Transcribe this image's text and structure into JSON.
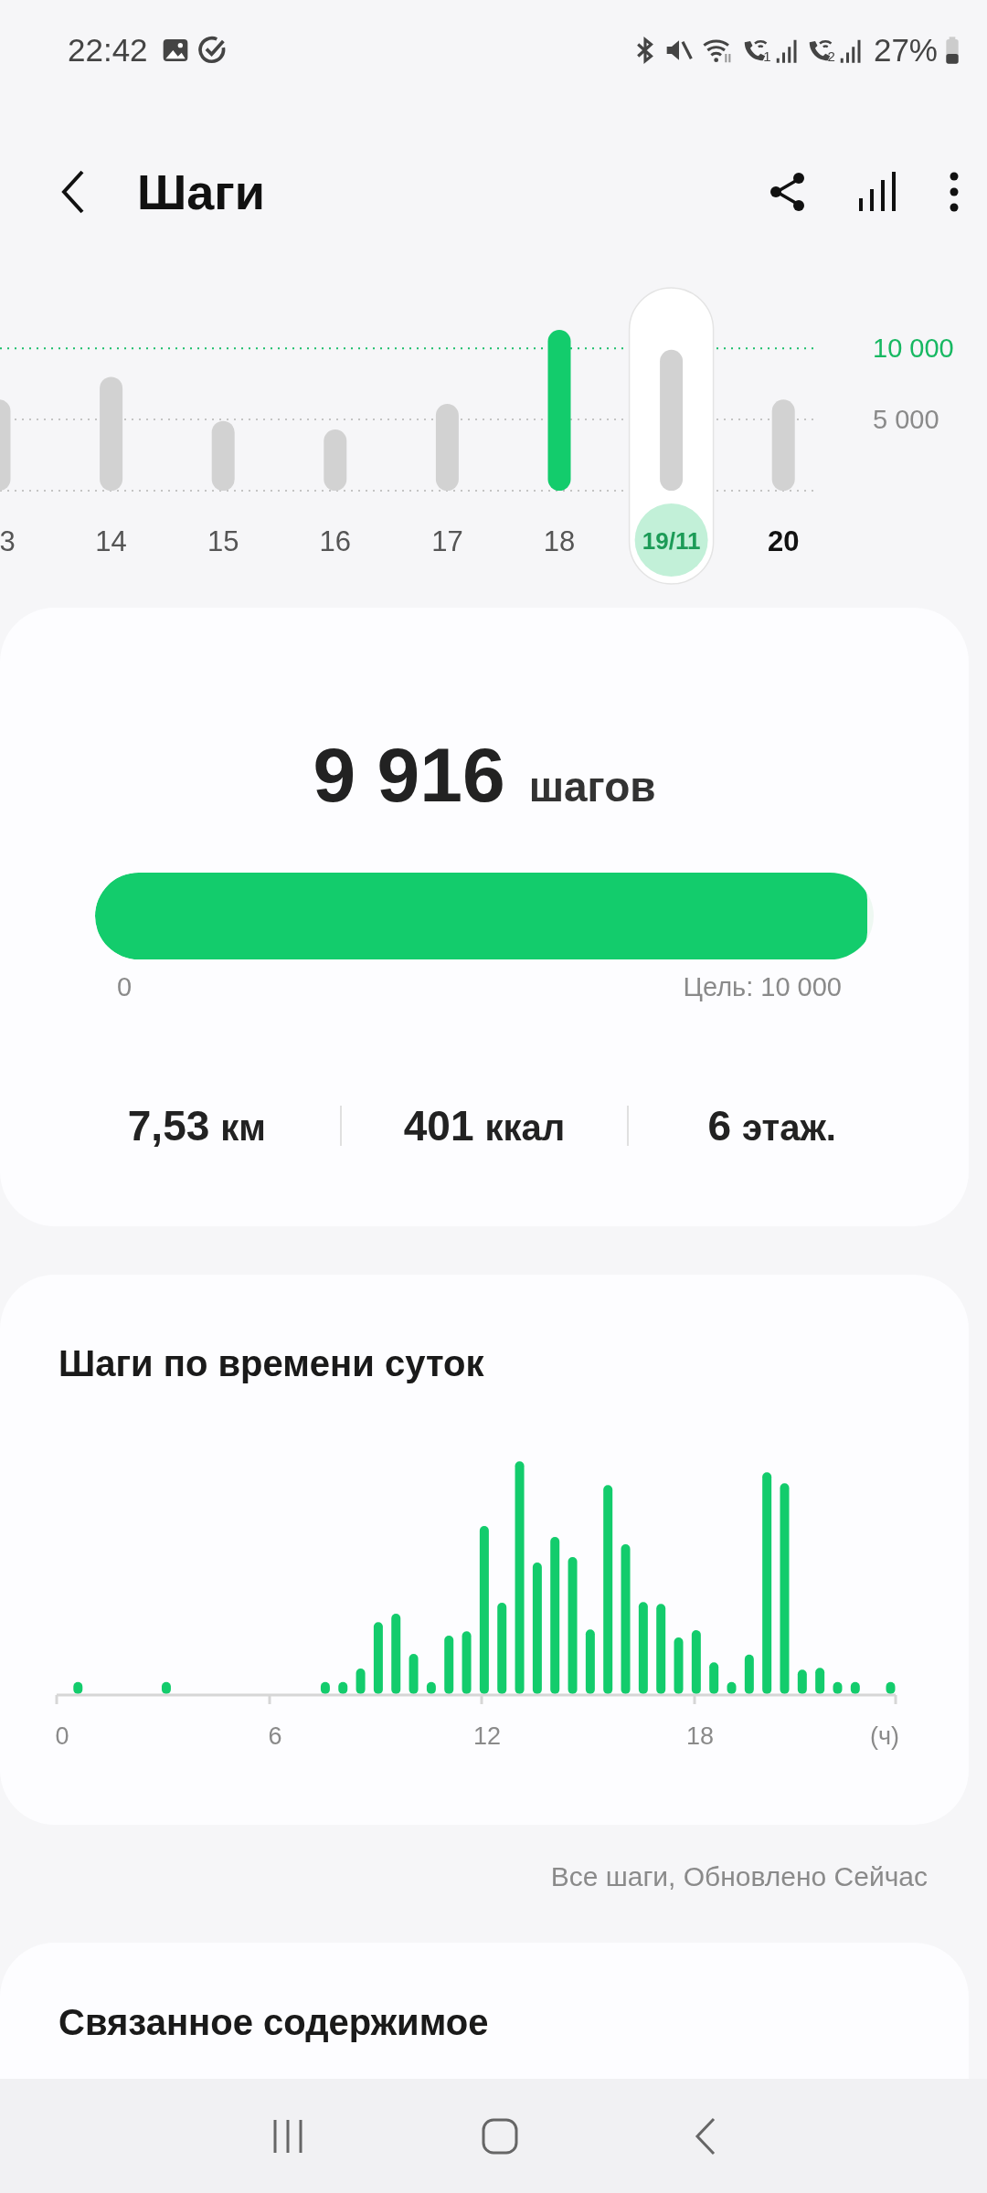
{
  "status_bar": {
    "time": "22:42",
    "sim_labels": [
      "1",
      "2"
    ],
    "battery": "27%"
  },
  "header": {
    "title": "Шаги"
  },
  "week_chart": {
    "chart_data": {
      "type": "bar",
      "categories": [
        "3",
        "14",
        "15",
        "16",
        "17",
        "18",
        "19/11",
        "20"
      ],
      "values": [
        6400,
        8000,
        4900,
        4300,
        6100,
        11300,
        9900,
        6400
      ],
      "yticks": [
        {
          "value": 5000,
          "label": "5 000"
        },
        {
          "value": 10000,
          "label": "10 000"
        }
      ],
      "ylim": [
        0,
        11300
      ]
    },
    "days": [
      {
        "selected": false,
        "emphasized": false
      },
      {
        "selected": false,
        "emphasized": false
      },
      {
        "selected": false,
        "emphasized": false
      },
      {
        "selected": false,
        "emphasized": false
      },
      {
        "selected": false,
        "emphasized": false
      },
      {
        "selected": false,
        "emphasized": false
      },
      {
        "selected": true,
        "emphasized": false
      },
      {
        "selected": false,
        "emphasized": true
      }
    ]
  },
  "summary": {
    "count": "9 916",
    "unit": "шагов",
    "level": 0.9916,
    "scale_start": "0",
    "goal_label": "Цель: 10 000",
    "stats": [
      {
        "value": "7,53",
        "unit": "км"
      },
      {
        "value": "401",
        "unit": "ккал"
      },
      {
        "value": "6",
        "unit": "этаж."
      }
    ]
  },
  "hourly": {
    "title": "Шаги по времени суток",
    "axis_labels": [
      "0",
      "6",
      "12",
      "18",
      "(ч)"
    ]
  },
  "footnote": "Все шаги, Обновлено Сейчас",
  "related": {
    "title": "Связанное содержимое"
  }
}
